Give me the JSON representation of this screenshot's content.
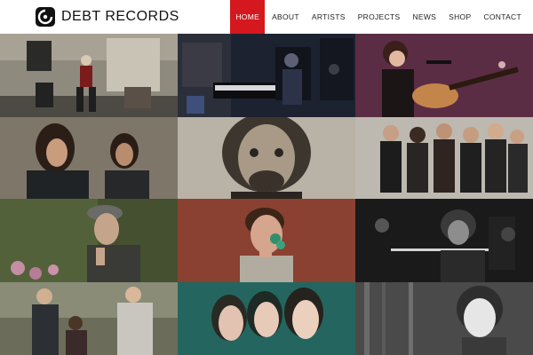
{
  "brand": {
    "name": "DEBT RECORDS",
    "logo_icon": "debt-records-logo-icon"
  },
  "nav": {
    "items": [
      {
        "label": "HOME",
        "active": true
      },
      {
        "label": "ABOUT",
        "active": false
      },
      {
        "label": "ARTISTS",
        "active": false
      },
      {
        "label": "PROJECTS",
        "active": false
      },
      {
        "label": "NEWS",
        "active": false
      },
      {
        "label": "SHOP",
        "active": false
      },
      {
        "label": "CONTACT",
        "active": false
      }
    ]
  },
  "colors": {
    "accent": "#d4181e",
    "header_bg": "#ffffff",
    "grid_bg": "#111111"
  },
  "grid": {
    "tiles": [
      {
        "name": "tile-pianist-studio"
      },
      {
        "name": "tile-keyboard-studio"
      },
      {
        "name": "tile-guitar-singer"
      },
      {
        "name": "tile-bearded-duo"
      },
      {
        "name": "tile-bearded-man-closeup"
      },
      {
        "name": "tile-band-group"
      },
      {
        "name": "tile-man-in-cap"
      },
      {
        "name": "tile-man-with-flowers"
      },
      {
        "name": "tile-flute-player"
      },
      {
        "name": "tile-trio-outdoors"
      },
      {
        "name": "tile-three-women-teal"
      },
      {
        "name": "tile-woman-bw-forest"
      }
    ]
  }
}
